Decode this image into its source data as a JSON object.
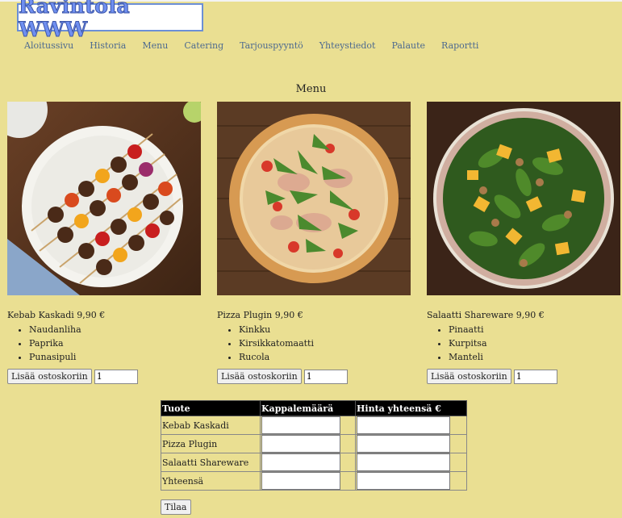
{
  "logo": "Ravintola WWW",
  "nav": [
    "Aloitussivu",
    "Historia",
    "Menu",
    "Catering",
    "Tarjouspyyntö",
    "Yhteystiedot",
    "Palaute",
    "Raportti"
  ],
  "page_title": "Menu",
  "products": [
    {
      "name": "Kebab Kaskadi 9,90 €",
      "ingredients": [
        "Naudanliha",
        "Paprika",
        "Punasipuli"
      ],
      "add_label": "Lisää ostoskoriin",
      "qty": "1"
    },
    {
      "name": "Pizza Plugin 9,90 €",
      "ingredients": [
        "Kinkku",
        "Kirsikkatomaatti",
        "Rucola"
      ],
      "add_label": "Lisää ostoskoriin",
      "qty": "1"
    },
    {
      "name": "Salaatti Shareware 9,90 €",
      "ingredients": [
        "Pinaatti",
        "Kurpitsa",
        "Manteli"
      ],
      "add_label": "Lisää ostoskoriin",
      "qty": "1"
    }
  ],
  "order_table": {
    "headers": [
      "Tuote",
      "Kappalemäärä",
      "Hinta yhteensä €"
    ],
    "rows": [
      "Kebab Kaskadi",
      "Pizza Plugin",
      "Salaatti Shareware",
      "Yhteensä"
    ]
  },
  "order_button": "Tilaa"
}
